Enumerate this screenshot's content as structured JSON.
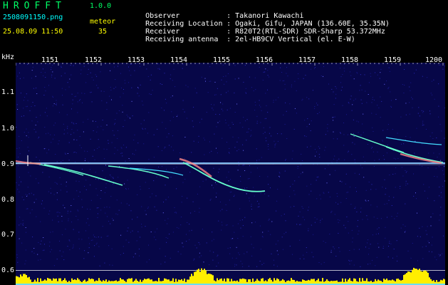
{
  "app": {
    "title": "HROFFT",
    "version": "1.0.0"
  },
  "file": {
    "name": "2508091150.png",
    "datetime": "25.08.09 11:50"
  },
  "detection": {
    "label": "meteor",
    "count": "35"
  },
  "info": [
    {
      "key": "Observer",
      "value": ": Takanori Kawachi"
    },
    {
      "key": "Receiving Location",
      "value": ": Ogaki, Gifu, JAPAN (136.60E, 35.35N)"
    },
    {
      "key": "Receiver",
      "value": ": R820T2(RTL-SDR) SDR-Sharp 53.372MHz"
    },
    {
      "key": "Receiving antenna",
      "value": ": 2el-HB9CV Vertical (el. E-W)"
    }
  ],
  "axes": {
    "y_unit": "kHz",
    "x_ticks": [
      "1151",
      "1152",
      "1153",
      "1154",
      "1155",
      "1156",
      "1157",
      "1158",
      "1159",
      "1200"
    ],
    "y_ticks": [
      "1.1",
      "1.0",
      "0.9",
      "0.8",
      "0.7",
      "0.6"
    ]
  },
  "colors": {
    "background": "#000000",
    "plot_bg": "#070748",
    "title": "#00ff66",
    "accent": "#00ffff",
    "label": "#ffff00",
    "carrier": "#88ccff",
    "echo": "#66ffcc",
    "noise": "#3333cc",
    "bar": "#ffee00",
    "bar_base": "#66ddff"
  }
}
